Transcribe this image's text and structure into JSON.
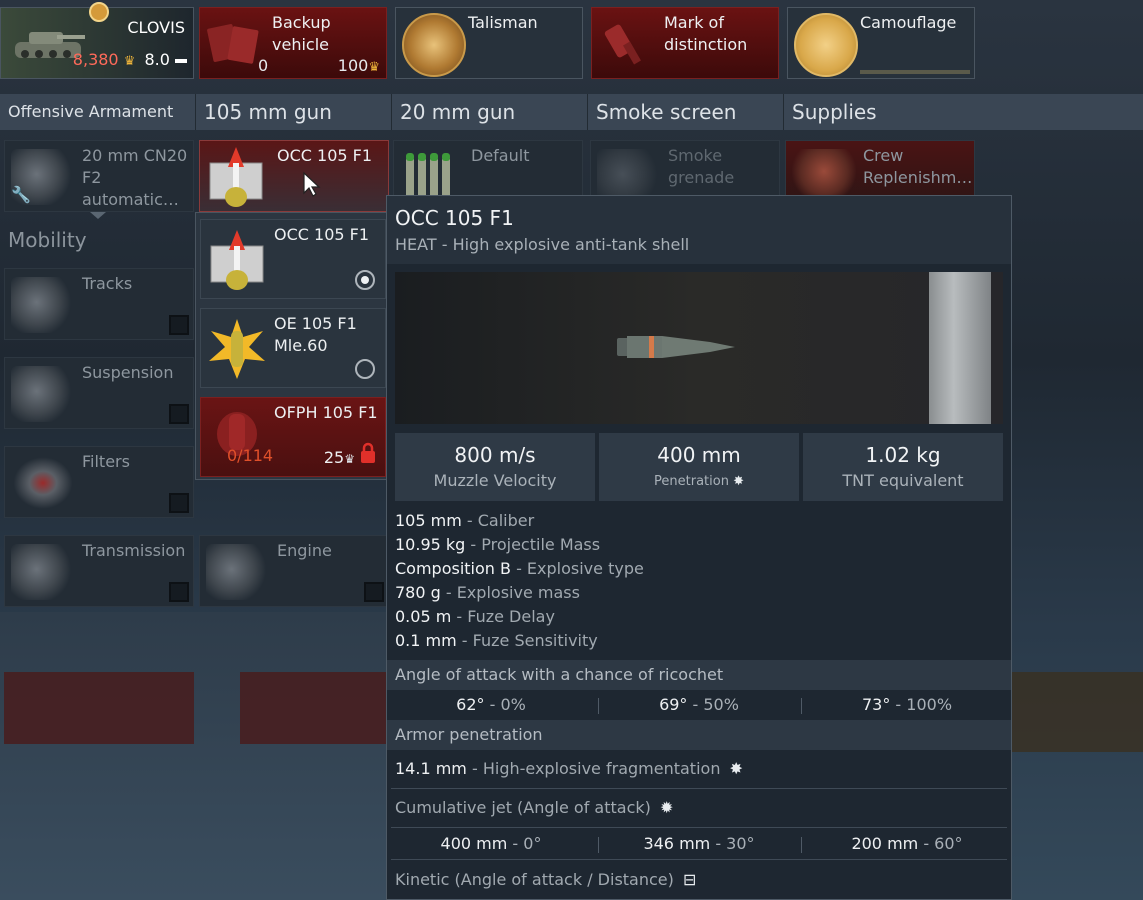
{
  "vehicle": {
    "name": "CLOVIS",
    "price": "8,380",
    "br": "8.0"
  },
  "slots": {
    "backup": {
      "label": "Backup vehicle",
      "count": "0",
      "cost": "100"
    },
    "talisman": {
      "label": "Talisman"
    },
    "mark": {
      "label": "Mark of distinction"
    },
    "camo": {
      "label": "Camouflage"
    }
  },
  "categories": [
    "Offensive Armament",
    "105 mm gun",
    "20 mm gun",
    "Smoke screen",
    "Supplies"
  ],
  "weapons_row": {
    "cn20": "20 mm CN20 F2 automatic…",
    "occ": "OCC 105 F1",
    "default": "Default",
    "smoke": "Smoke grenade",
    "crew": "Crew Replenishm…"
  },
  "mobility": {
    "title": "Mobility",
    "tracks": "Tracks",
    "suspension": "Suspension",
    "filters": "Filters",
    "transmission": "Transmission",
    "engine": "Engine"
  },
  "dropdown": [
    {
      "label": "OCC 105 F1",
      "selected": true
    },
    {
      "label": "OE 105 F1 Mle.60",
      "selected": false
    },
    {
      "label": "OFPH 105 F1",
      "progress": "0/114",
      "cost": "25",
      "locked": true
    }
  ],
  "tooltip": {
    "title": "OCC 105 F1",
    "subtitle": "HEAT - High explosive anti-tank shell",
    "stats": [
      {
        "value": "800 m/s",
        "name": "Muzzle Velocity"
      },
      {
        "value": "400 mm",
        "name": "Penetration"
      },
      {
        "value": "1.02 kg",
        "name": "TNT equivalent"
      }
    ],
    "props": [
      {
        "v": "105 mm",
        "d": " - Caliber"
      },
      {
        "v": "10.95 kg",
        "d": " - Projectile Mass"
      },
      {
        "v": "Composition B",
        "d": " - Explosive type"
      },
      {
        "v": "780 g",
        "d": " - Explosive mass"
      },
      {
        "v": "0.05 m",
        "d": " - Fuze Delay"
      },
      {
        "v": "0.1 mm",
        "d": " - Fuze Sensitivity"
      }
    ],
    "ricochet_title": "Angle of attack with a chance of ricochet",
    "ricochet": [
      {
        "a": "62°",
        "p": " - 0%"
      },
      {
        "a": "69°",
        "p": " - 50%"
      },
      {
        "a": "73°",
        "p": " - 100%"
      }
    ],
    "armor_title": "Armor penetration",
    "he_frag": {
      "v": "14.1 mm",
      "d": " - High-explosive fragmentation"
    },
    "jet_title": "Cumulative jet (Angle of attack)",
    "jet": [
      {
        "a": "400 mm",
        "p": " - 0°"
      },
      {
        "a": "346 mm",
        "p": " - 30°"
      },
      {
        "a": "200 mm",
        "p": " - 60°"
      }
    ],
    "kinetic_title": "Kinetic (Angle of attack / Distance)"
  },
  "colors": {
    "accent_gold": "#f0b53a",
    "price_red": "#ff6a5a",
    "lock_red": "#e0302a"
  }
}
